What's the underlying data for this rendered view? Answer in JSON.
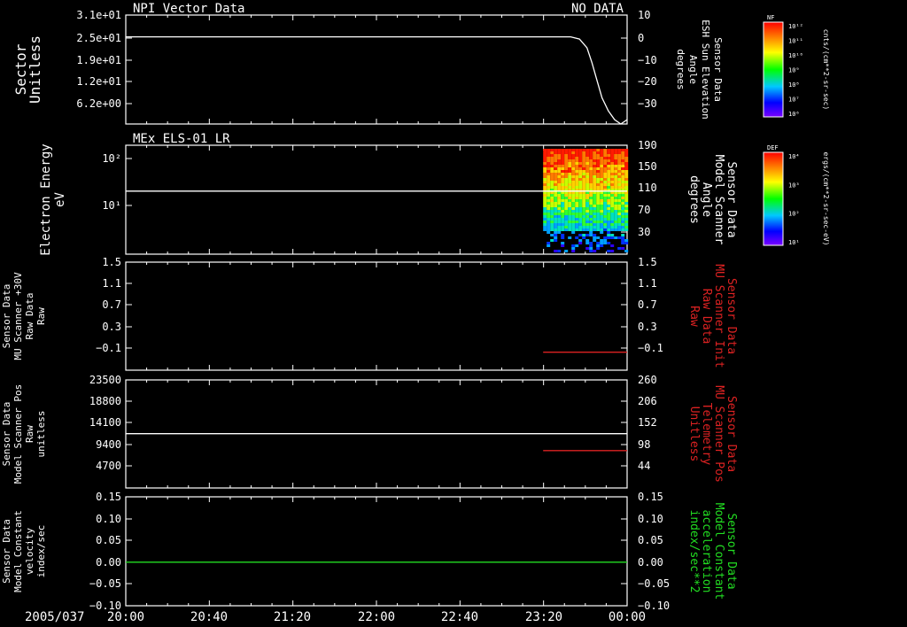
{
  "chart_data": [
    {
      "type": "line",
      "title": "NPI Vector Data",
      "status": "NO DATA",
      "ylabel_left": [
        "Sector",
        "Unitless"
      ],
      "yticks_left": [
        "3.1e+01",
        "2.5e+01",
        "1.9e+01",
        "1.2e+01",
        "6.2e+00"
      ],
      "ylabel_right": [
        "Sensor Data",
        "ESH Sun Elevation",
        "Angle",
        "degrees"
      ],
      "yticks_right": [
        "10",
        "0",
        "−10",
        "−20",
        "−30"
      ],
      "ylim_right": [
        -40,
        10
      ],
      "series": [
        {
          "color": "#ffffff",
          "x": [
            0,
            3.0,
            3.3,
            3.45,
            3.55,
            3.62,
            3.68,
            3.72,
            3.76,
            3.8,
            3.85,
            3.9,
            3.95,
            4.0
          ],
          "y": [
            0,
            0,
            0,
            0,
            0,
            -1,
            -5,
            -12,
            -20,
            -28,
            -34,
            -38,
            -40,
            -38
          ]
        }
      ]
    },
    {
      "type": "heatmap",
      "title": "MEx ELS-01 LR",
      "ylabel_left": [
        "Electron Energy",
        "eV"
      ],
      "yticks_left": [
        "10²",
        "10¹"
      ],
      "ylabel_right": [
        "Sensor Data",
        "Model Scanner",
        "Angle",
        "degrees"
      ],
      "yticks_right": [
        "190",
        "150",
        "110",
        "70",
        "30"
      ],
      "ylim_right": [
        0,
        190
      ],
      "series": [
        {
          "color": "#ffffff",
          "x": [
            0,
            4.0
          ],
          "y": [
            110,
            110
          ]
        }
      ]
    },
    {
      "type": "line",
      "ylabel_left": [
        "Sensor Data",
        "MU Scanner +30V",
        "Raw Data",
        "Raw"
      ],
      "yticks_left": [
        "1.5",
        "1.1",
        "0.7",
        "0.3",
        "−0.1"
      ],
      "ylabel_right": [
        "Sensor Data",
        "MU Scanner Init",
        "Raw Data",
        "Raw"
      ],
      "yticks_right": [
        "1.5",
        "1.1",
        "0.7",
        "0.3",
        "−0.1"
      ],
      "ylim_right": [
        -0.3,
        1.5
      ],
      "series": [
        {
          "color": "#dd2222",
          "x": [
            3.33,
            4.0
          ],
          "y": [
            0,
            0
          ]
        }
      ]
    },
    {
      "type": "line",
      "ylabel_left": [
        "Sensor Data",
        "Model Scanner Pos",
        "Raw",
        "unitless"
      ],
      "yticks_left": [
        "23500",
        "18800",
        "14100",
        "9400",
        "4700"
      ],
      "ylim_left": [
        0,
        23500
      ],
      "ylabel_right": [
        "Sensor Data",
        "MU Scanner Pos",
        "Telemetry",
        "Unitless"
      ],
      "yticks_right": [
        "260",
        "206",
        "152",
        "98",
        "44"
      ],
      "ylim_right": [
        0,
        260
      ],
      "series": [
        {
          "color": "#ffffff",
          "axis": "left",
          "x": [
            0,
            4.0
          ],
          "y": [
            11800,
            11800
          ]
        },
        {
          "color": "#dd2222",
          "axis": "right",
          "x": [
            3.33,
            4.0
          ],
          "y": [
            90,
            90
          ]
        }
      ]
    },
    {
      "type": "line",
      "ylabel_left": [
        "Sensor Data",
        "Model Constant",
        "velocity",
        "index/sec"
      ],
      "yticks_left": [
        "0.15",
        "0.10",
        "0.05",
        "0.00",
        "−0.05",
        "−0.10"
      ],
      "ylim_left": [
        -0.1,
        0.15
      ],
      "ylabel_right": [
        "Sensor Data",
        "Model Constant",
        "acceleration",
        "index/sec**2"
      ],
      "yticks_right": [
        "0.15",
        "0.10",
        "0.05",
        "0.00",
        "−0.05",
        "−0.10"
      ],
      "series": [
        {
          "color": "#22dd22",
          "x": [
            0,
            4.0
          ],
          "y": [
            0,
            0
          ]
        }
      ]
    }
  ],
  "x_axis": {
    "date": "2005/037",
    "ticks": [
      "20:00",
      "20:40",
      "21:20",
      "22:00",
      "22:40",
      "23:20",
      "00:00"
    ]
  },
  "colorbars": [
    {
      "label": "NF",
      "unit": "cnts/(cm**2-sr-sec)",
      "ticks": [
        "10¹²",
        "10¹¹",
        "10¹⁰",
        "10⁹",
        "10⁸",
        "10⁷",
        "10⁶"
      ]
    },
    {
      "label": "DEF",
      "unit": "ergs/(cm**2-sr-sec-eV)",
      "ticks": [
        "10⁴",
        "10³",
        "10²",
        "10¹"
      ]
    }
  ],
  "colors": {
    "background": "#000000",
    "foreground": "#ffffff",
    "red": "#dd2222",
    "green": "#22dd22"
  }
}
